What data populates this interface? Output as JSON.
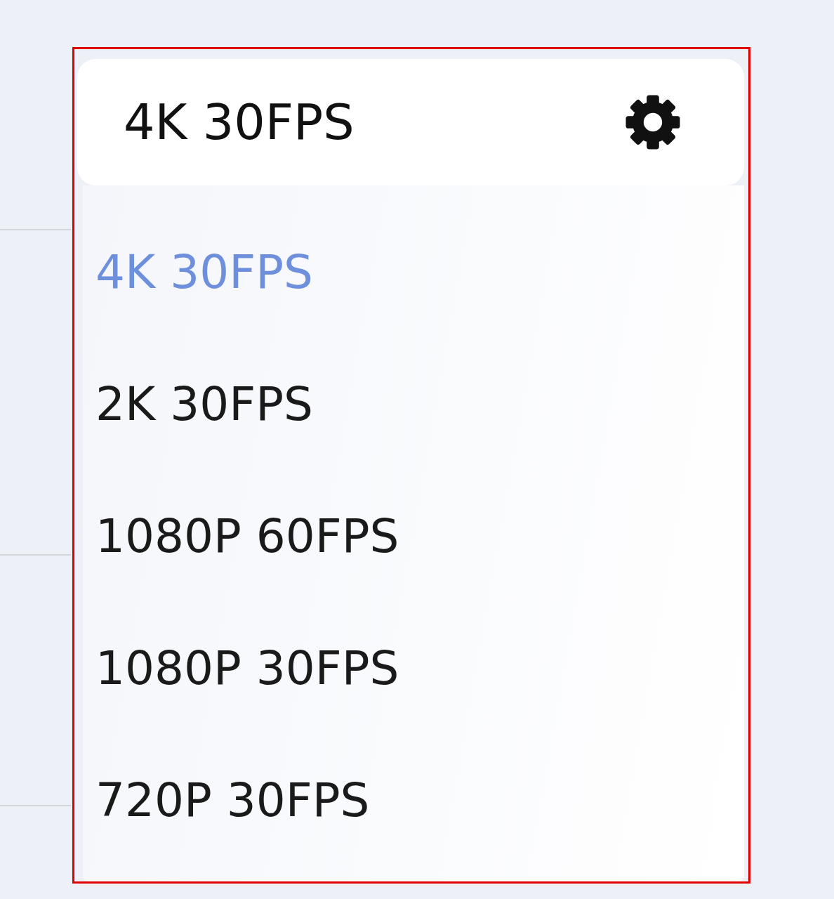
{
  "selector": {
    "value": "4K 30FPS"
  },
  "options": [
    {
      "label": "4K 30FPS",
      "selected": true
    },
    {
      "label": "2K 30FPS",
      "selected": false
    },
    {
      "label": "1080P 60FPS",
      "selected": false
    },
    {
      "label": "1080P 30FPS",
      "selected": false
    },
    {
      "label": "720P 30FPS",
      "selected": false
    }
  ]
}
